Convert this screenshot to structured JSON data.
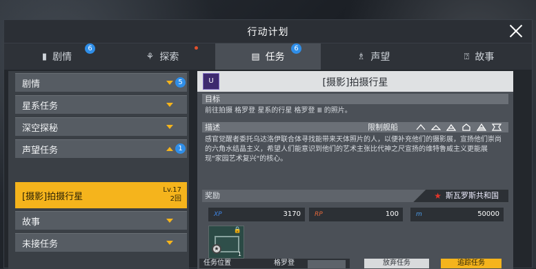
{
  "window": {
    "title": "行动计划"
  },
  "tabs": [
    {
      "label": "剧情",
      "badge": "6"
    },
    {
      "label": "探索"
    },
    {
      "label": "任务",
      "badge": "6"
    },
    {
      "label": "声望"
    },
    {
      "label": "故事"
    }
  ],
  "sidebar": {
    "items": [
      {
        "label": "剧情",
        "badge": "5"
      },
      {
        "label": "星系任务"
      },
      {
        "label": "深空探秘"
      },
      {
        "label": "声望任务",
        "badge": "1"
      },
      {
        "label": "故事"
      },
      {
        "label": "未接任务"
      }
    ],
    "selected": {
      "label": "[摄影]拍摄行星",
      "level": "Lv.17",
      "count": "2回"
    }
  },
  "quest": {
    "icon_text": "U",
    "title": "[摄影]拍摄行星",
    "goal_label": "目标",
    "goal_text": "前往拍摄 格罗登 星系的行星 格罗登 Ⅲ 的照片。",
    "desc_label": "描述",
    "ship_limit_label": "限制舰船",
    "desc_text": "感官觉醒者委托乌达洛伊联合体寻找能带来天体照片的人，以便补充他们的摄影展，宣扬他们崇尚的六角水结晶主义，希望人们能意识到他们的艺术主张比代神之尺宣扬的维特鲁威主义更能展现\"家园艺术复兴\"的核心。",
    "reward_label": "奖励",
    "faction": "斯瓦罗斯共和国",
    "stats": [
      {
        "key": "XP",
        "value": "3170"
      },
      {
        "key": "RP",
        "value": "100"
      },
      {
        "key": "m",
        "value": "50000"
      }
    ],
    "item_count": "1"
  },
  "footer": {
    "location_label": "任务位置",
    "location_value": "格罗登",
    "btn_dark": "放弃任务",
    "btn_gold": "追踪任务"
  },
  "colors": {
    "accent": "#f5b41c",
    "badge": "#2f8ee8",
    "faction_star": "#e4352a"
  }
}
